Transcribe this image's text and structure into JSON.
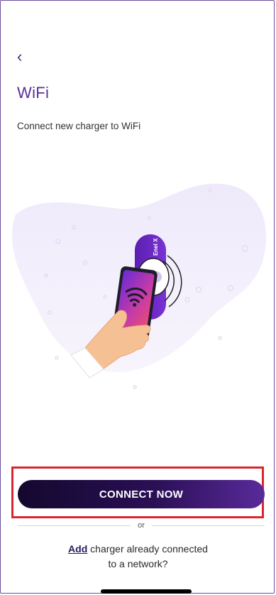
{
  "header": {
    "back_icon": "chevron-left-icon",
    "title": "WiFi",
    "subtitle": "Connect new charger to WiFi"
  },
  "illustration": {
    "charger_brand": "Enel X"
  },
  "actions": {
    "connect_label": "CONNECT NOW",
    "or_label": "or",
    "add_link_label": "Add",
    "add_text_1": " charger already connected",
    "add_text_2": "to a network?"
  },
  "colors": {
    "accent": "#5a2d9c",
    "cta_start": "#14082e",
    "cta_end": "#5a2a9a",
    "highlight": "#d9262e"
  }
}
